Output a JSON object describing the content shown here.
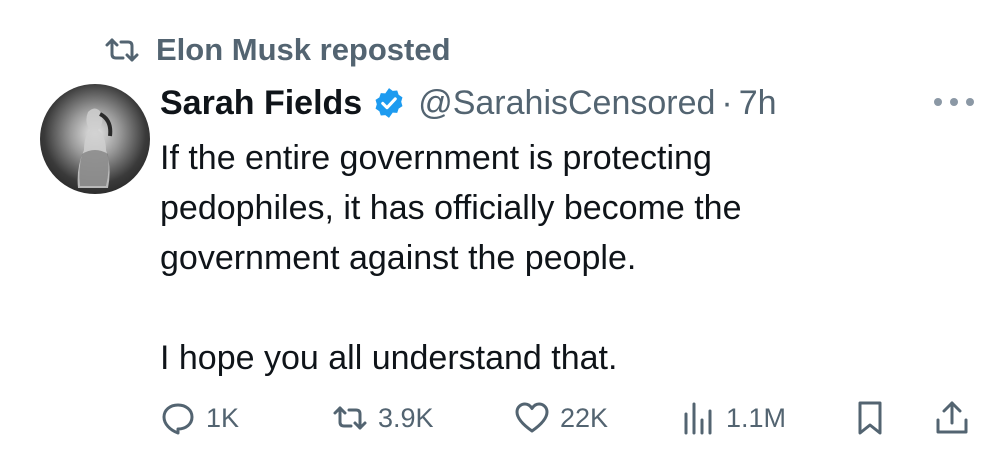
{
  "repost_banner": {
    "text": "Elon Musk reposted",
    "icon": "repost-icon"
  },
  "author": {
    "name": "Sarah Fields",
    "handle": "@SarahisCensored",
    "separator": "·",
    "time": "7h",
    "verified": true,
    "verified_color": "#1d9bf0"
  },
  "tweet": {
    "lines": [
      "If the entire government is protecting",
      "pedophiles, it has officially become the",
      "government against the people.",
      "",
      "I hope you all understand that."
    ]
  },
  "actions": {
    "reply_count": "1K",
    "repost_count": "3.9K",
    "like_count": "22K",
    "views_count": "1.1M"
  },
  "colors": {
    "text": "#0f1419",
    "secondary": "#536471",
    "accent": "#1d9bf0"
  }
}
